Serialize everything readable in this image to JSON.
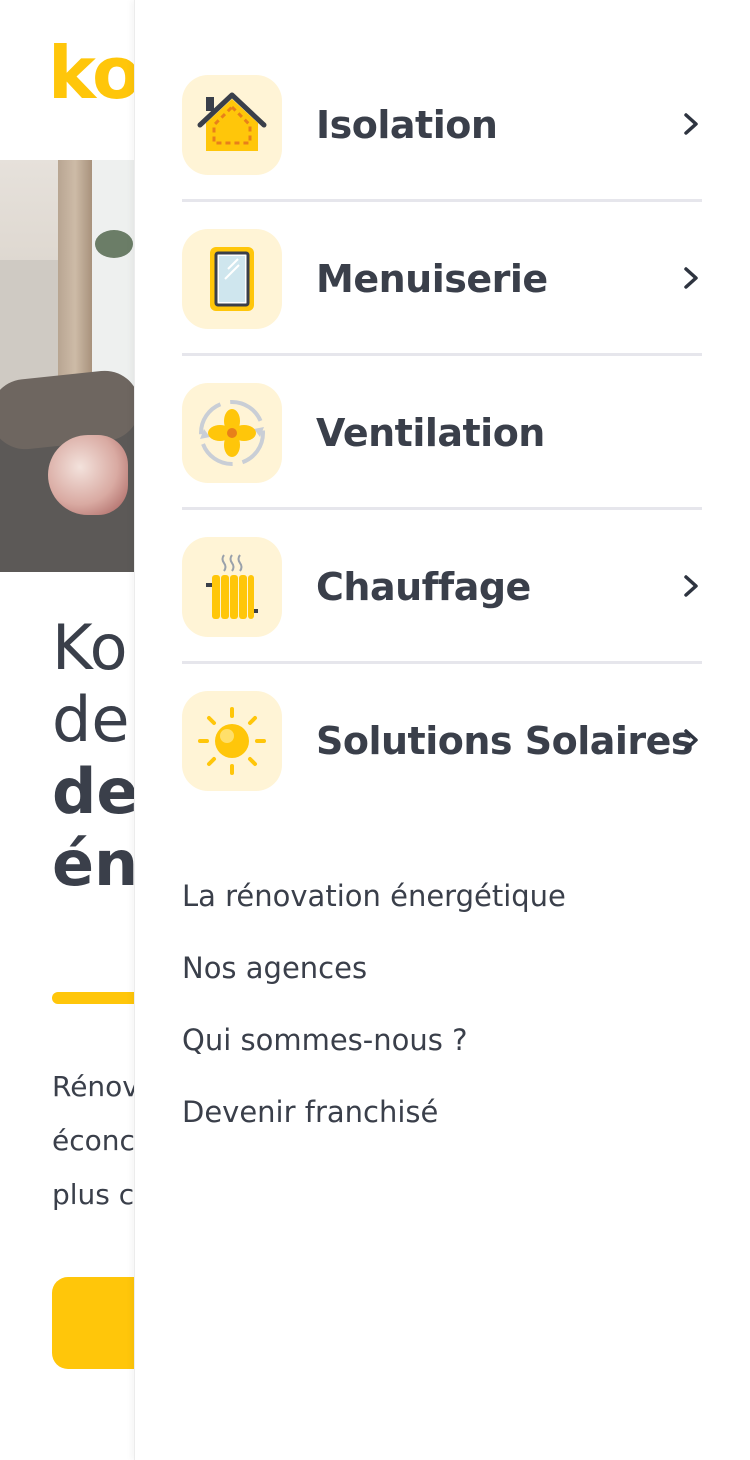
{
  "brand": {
    "logo_text": "ko",
    "accent_color": "#ffc60a"
  },
  "hero": {
    "line1": "Ko",
    "line2": "de:",
    "line3": "de",
    "line4": "én",
    "desc1": "Rénov",
    "desc2": "éconc",
    "desc3": "plus c"
  },
  "menu": {
    "items": [
      {
        "label": "Isolation",
        "icon": "house-insulation-icon",
        "has_submenu": true
      },
      {
        "label": "Menuiserie",
        "icon": "window-icon",
        "has_submenu": true
      },
      {
        "label": "Ventilation",
        "icon": "fan-icon",
        "has_submenu": false
      },
      {
        "label": "Chauffage",
        "icon": "radiator-icon",
        "has_submenu": true
      },
      {
        "label": "Solutions Solaires",
        "icon": "sun-icon",
        "has_submenu": true
      }
    ]
  },
  "links": [
    "La rénovation énergétique",
    "Nos agences",
    "Qui sommes-nous ?",
    "Devenir franchisé"
  ]
}
